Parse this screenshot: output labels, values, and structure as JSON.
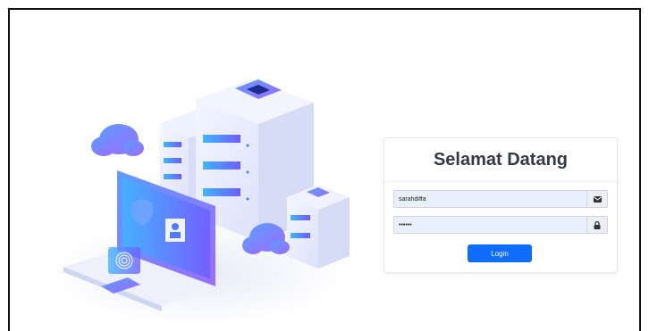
{
  "login": {
    "title": "Selamat Datang",
    "username_value": "sarahdiffa",
    "password_value": "••••••",
    "login_label": "Login"
  },
  "icons": {
    "username_icon": "envelope-icon",
    "password_icon": "lock-icon"
  },
  "colors": {
    "primary_button": "#0d6efd",
    "input_fill": "#e8f0fe",
    "illustration_accent": "#4f7cff"
  }
}
